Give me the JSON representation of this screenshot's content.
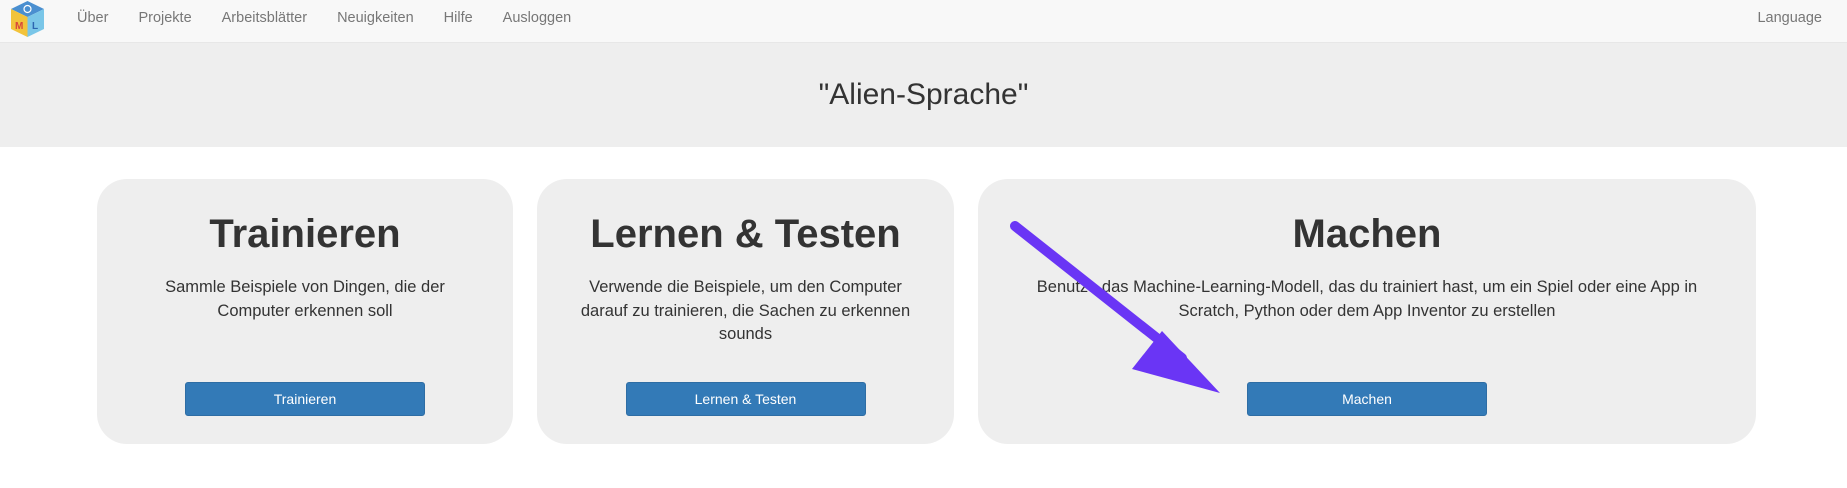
{
  "nav": {
    "links": [
      "Über",
      "Projekte",
      "Arbeitsblätter",
      "Neuigkeiten",
      "Hilfe",
      "Ausloggen"
    ],
    "language": "Language",
    "logo_letters": [
      "M",
      "L"
    ]
  },
  "project_title": "\"Alien-Sprache\"",
  "cards": [
    {
      "title": "Trainieren",
      "description": "Sammle Beispiele von Dingen, die der Computer erkennen soll",
      "button": "Trainieren"
    },
    {
      "title": "Lernen & Testen",
      "description": "Verwende die Beispiele, um den Computer darauf zu trainieren, die Sachen zu erkennen sounds",
      "button": "Lernen & Testen"
    },
    {
      "title": "Machen",
      "description": "Benutze das Machine-Learning-Modell, das du trainiert hast, um ein Spiel oder eine App in Scratch, Python oder dem App Inventor zu erstellen",
      "button": "Machen"
    }
  ],
  "colors": {
    "button": "#337ab7",
    "annotation_arrow": "#6a35f5",
    "card_background": "#eeeeee",
    "navbar_background": "#f8f8f8"
  },
  "icons": {
    "logo": "ml-cube-logo-icon",
    "annotation": "pointer-arrow-annotation"
  }
}
